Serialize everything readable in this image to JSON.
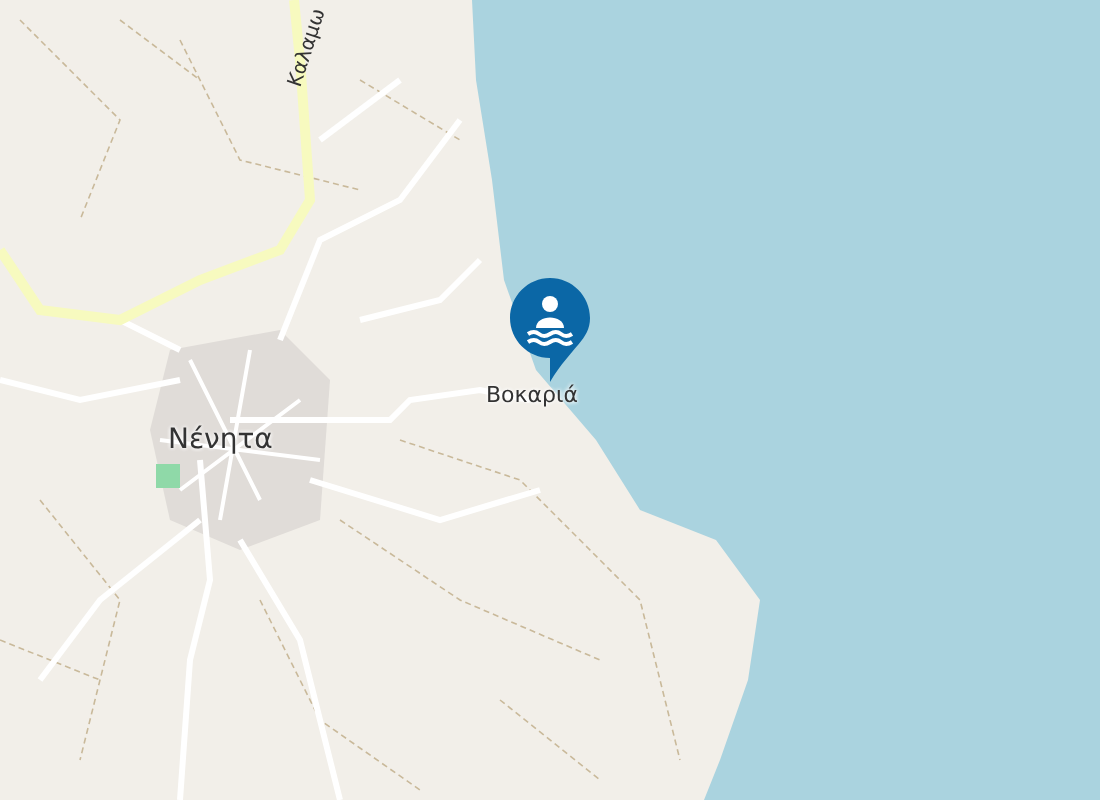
{
  "map": {
    "road_label": "Καλαμω",
    "places": [
      {
        "name": "Νένητα",
        "kind": "town"
      },
      {
        "name": "Βοκαριά",
        "kind": "beach"
      }
    ],
    "marker": {
      "kind": "swimming"
    }
  }
}
